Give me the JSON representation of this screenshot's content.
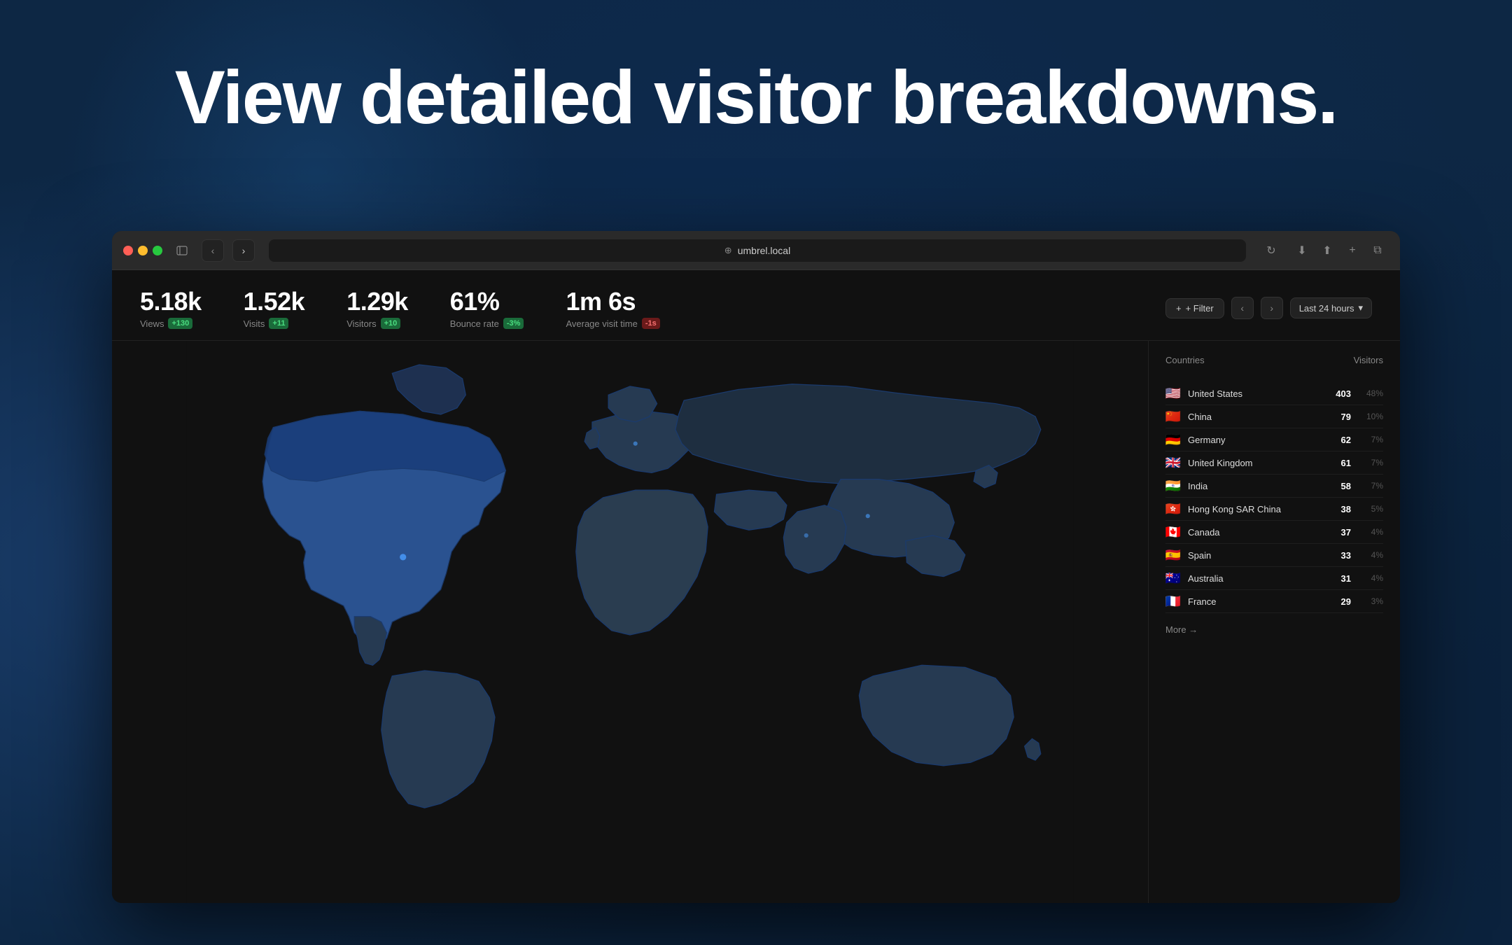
{
  "hero": {
    "title": "View detailed visitor breakdowns."
  },
  "browser": {
    "url": "umbrel.local",
    "nav_back": "‹",
    "nav_forward": "›",
    "reload": "↻"
  },
  "stats": [
    {
      "id": "views",
      "value": "5.18k",
      "label": "Views",
      "badge": "+130",
      "badge_type": "green"
    },
    {
      "id": "visits",
      "value": "1.52k",
      "label": "Visits",
      "badge": "+11",
      "badge_type": "green"
    },
    {
      "id": "visitors",
      "value": "1.29k",
      "label": "Visitors",
      "badge": "+10",
      "badge_type": "green"
    },
    {
      "id": "bounce_rate",
      "value": "61%",
      "label": "Bounce rate",
      "badge": "-3%",
      "badge_type": "green"
    },
    {
      "id": "avg_visit",
      "value": "1m 6s",
      "label": "Average visit time",
      "badge": "-1s",
      "badge_type": "red"
    }
  ],
  "filter": {
    "label": "+ Filter",
    "time_range": "Last 24 hours"
  },
  "countries_table": {
    "col_countries": "Countries",
    "col_visitors": "Visitors",
    "rows": [
      {
        "flag": "🇺🇸",
        "name": "United States",
        "count": "403",
        "pct": "48%"
      },
      {
        "flag": "🇨🇳",
        "name": "China",
        "count": "79",
        "pct": "10%"
      },
      {
        "flag": "🇩🇪",
        "name": "Germany",
        "count": "62",
        "pct": "7%"
      },
      {
        "flag": "🇬🇧",
        "name": "United Kingdom",
        "count": "61",
        "pct": "7%"
      },
      {
        "flag": "🇮🇳",
        "name": "India",
        "count": "58",
        "pct": "7%"
      },
      {
        "flag": "🇭🇰",
        "name": "Hong Kong SAR China",
        "count": "38",
        "pct": "5%"
      },
      {
        "flag": "🇨🇦",
        "name": "Canada",
        "count": "37",
        "pct": "4%"
      },
      {
        "flag": "🇪🇸",
        "name": "Spain",
        "count": "33",
        "pct": "4%"
      },
      {
        "flag": "🇦🇺",
        "name": "Australia",
        "count": "31",
        "pct": "4%"
      },
      {
        "flag": "🇫🇷",
        "name": "France",
        "count": "29",
        "pct": "3%"
      }
    ],
    "more_label": "More →"
  }
}
